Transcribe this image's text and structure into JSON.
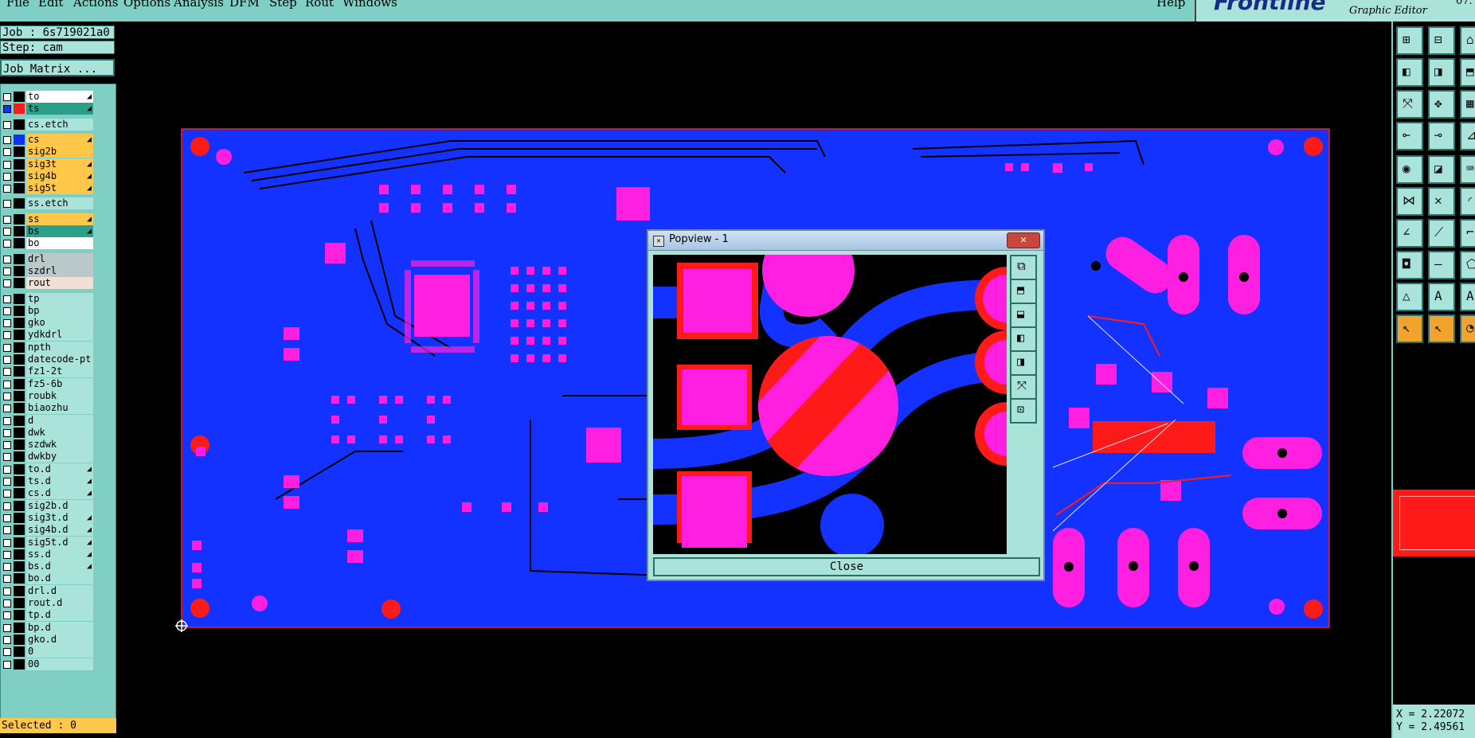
{
  "menu": {
    "items": [
      "File",
      "Edit",
      "Actions",
      "Options",
      "Analysis",
      "DFM",
      "Step",
      "Rout",
      "Windows"
    ],
    "help": "Help"
  },
  "brand": {
    "logo": "Frontline",
    "subtitle": "Graphic Editor",
    "version": "07."
  },
  "job": {
    "label": "Job : 6s719021a0",
    "step": "Step: cam",
    "matrix_button": "Job Matrix ..."
  },
  "layers": [
    {
      "name": "to",
      "color": "#ffffff",
      "swatch": "#000000",
      "arrow": true
    },
    {
      "name": "ts",
      "color": "#2aa08a",
      "swatch": "#ff1a1a",
      "arrow": true,
      "selected": true
    },
    {
      "name": "cs.etch",
      "color": "#a9e3da",
      "swatch": "#000000",
      "arrow": false
    },
    {
      "name": "cs",
      "color": "#ffc84a",
      "swatch": "#1030ff",
      "arrow": true
    },
    {
      "name": "sig2b",
      "color": "#ffc84a",
      "swatch": "#000000",
      "arrow": false
    },
    {
      "name": "sig3t",
      "color": "#ffc84a",
      "swatch": "#000000",
      "arrow": true
    },
    {
      "name": "sig4b",
      "color": "#ffc84a",
      "swatch": "#000000",
      "arrow": true
    },
    {
      "name": "sig5t",
      "color": "#ffc84a",
      "swatch": "#000000",
      "arrow": true
    },
    {
      "name": "ss.etch",
      "color": "#a9e3da",
      "swatch": "#000000",
      "arrow": false
    },
    {
      "name": "ss",
      "color": "#ffc84a",
      "swatch": "#000000",
      "arrow": true
    },
    {
      "name": "bs",
      "color": "#2aa08a",
      "swatch": "#000000",
      "arrow": true
    },
    {
      "name": "bo",
      "color": "#ffffff",
      "swatch": "#000000",
      "arrow": false
    },
    {
      "name": "drl",
      "color": "#b9c9c9",
      "swatch": "#000000",
      "arrow": false
    },
    {
      "name": "szdrl",
      "color": "#b9c9c9",
      "swatch": "#000000",
      "arrow": false
    },
    {
      "name": "rout",
      "color": "#f0e0d8",
      "swatch": "#000000",
      "arrow": false
    },
    {
      "name": "tp",
      "color": "#a9e3da",
      "swatch": "#000000",
      "arrow": false
    },
    {
      "name": "bp",
      "color": "#a9e3da",
      "swatch": "#000000",
      "arrow": false
    },
    {
      "name": "gko",
      "color": "#a9e3da",
      "swatch": "#000000",
      "arrow": false
    },
    {
      "name": "ydkdrl",
      "color": "#a9e3da",
      "swatch": "#000000",
      "arrow": false
    },
    {
      "name": "npth",
      "color": "#a9e3da",
      "swatch": "#000000",
      "arrow": false
    },
    {
      "name": "datecode-pt",
      "color": "#a9e3da",
      "swatch": "#000000",
      "arrow": false
    },
    {
      "name": "fz1-2t",
      "color": "#a9e3da",
      "swatch": "#000000",
      "arrow": false
    },
    {
      "name": "fz5-6b",
      "color": "#a9e3da",
      "swatch": "#000000",
      "arrow": false
    },
    {
      "name": "roubk",
      "color": "#a9e3da",
      "swatch": "#000000",
      "arrow": false
    },
    {
      "name": "biaozhu",
      "color": "#a9e3da",
      "swatch": "#000000",
      "arrow": false
    },
    {
      "name": "d",
      "color": "#a9e3da",
      "swatch": "#000000",
      "arrow": false
    },
    {
      "name": "dwk",
      "color": "#a9e3da",
      "swatch": "#000000",
      "arrow": false
    },
    {
      "name": "szdwk",
      "color": "#a9e3da",
      "swatch": "#000000",
      "arrow": false
    },
    {
      "name": "dwkby",
      "color": "#a9e3da",
      "swatch": "#000000",
      "arrow": false
    },
    {
      "name": "to.d",
      "color": "#a9e3da",
      "swatch": "#000000",
      "arrow": true
    },
    {
      "name": "ts.d",
      "color": "#a9e3da",
      "swatch": "#000000",
      "arrow": true
    },
    {
      "name": "cs.d",
      "color": "#a9e3da",
      "swatch": "#000000",
      "arrow": true
    },
    {
      "name": "sig2b.d",
      "color": "#a9e3da",
      "swatch": "#000000",
      "arrow": false
    },
    {
      "name": "sig3t.d",
      "color": "#a9e3da",
      "swatch": "#000000",
      "arrow": true
    },
    {
      "name": "sig4b.d",
      "color": "#a9e3da",
      "swatch": "#000000",
      "arrow": true
    },
    {
      "name": "sig5t.d",
      "color": "#a9e3da",
      "swatch": "#000000",
      "arrow": true
    },
    {
      "name": "ss.d",
      "color": "#a9e3da",
      "swatch": "#000000",
      "arrow": true
    },
    {
      "name": "bs.d",
      "color": "#a9e3da",
      "swatch": "#000000",
      "arrow": true
    },
    {
      "name": "bo.d",
      "color": "#a9e3da",
      "swatch": "#000000",
      "arrow": false
    },
    {
      "name": "drl.d",
      "color": "#a9e3da",
      "swatch": "#000000",
      "arrow": false
    },
    {
      "name": "rout.d",
      "color": "#a9e3da",
      "swatch": "#000000",
      "arrow": false
    },
    {
      "name": "tp.d",
      "color": "#a9e3da",
      "swatch": "#000000",
      "arrow": false
    },
    {
      "name": "bp.d",
      "color": "#a9e3da",
      "swatch": "#000000",
      "arrow": false
    },
    {
      "name": "gko.d",
      "color": "#a9e3da",
      "swatch": "#000000",
      "arrow": false
    },
    {
      "name": "0",
      "color": "#a9e3da",
      "swatch": "#000000",
      "arrow": false
    },
    {
      "name": "00",
      "color": "#a9e3da",
      "swatch": "#000000",
      "arrow": false
    }
  ],
  "status": {
    "selected": "Selected : 0"
  },
  "coords": {
    "x": "X = 2.22072",
    "y": "Y = 2.49561"
  },
  "popview": {
    "title": "Popview - 1",
    "close_label": "Close"
  },
  "colors": {
    "board": "#1432ff",
    "pad": "#ff1fe0",
    "copper": "#ff1a1a",
    "ui_teal": "#7fcfc4"
  }
}
